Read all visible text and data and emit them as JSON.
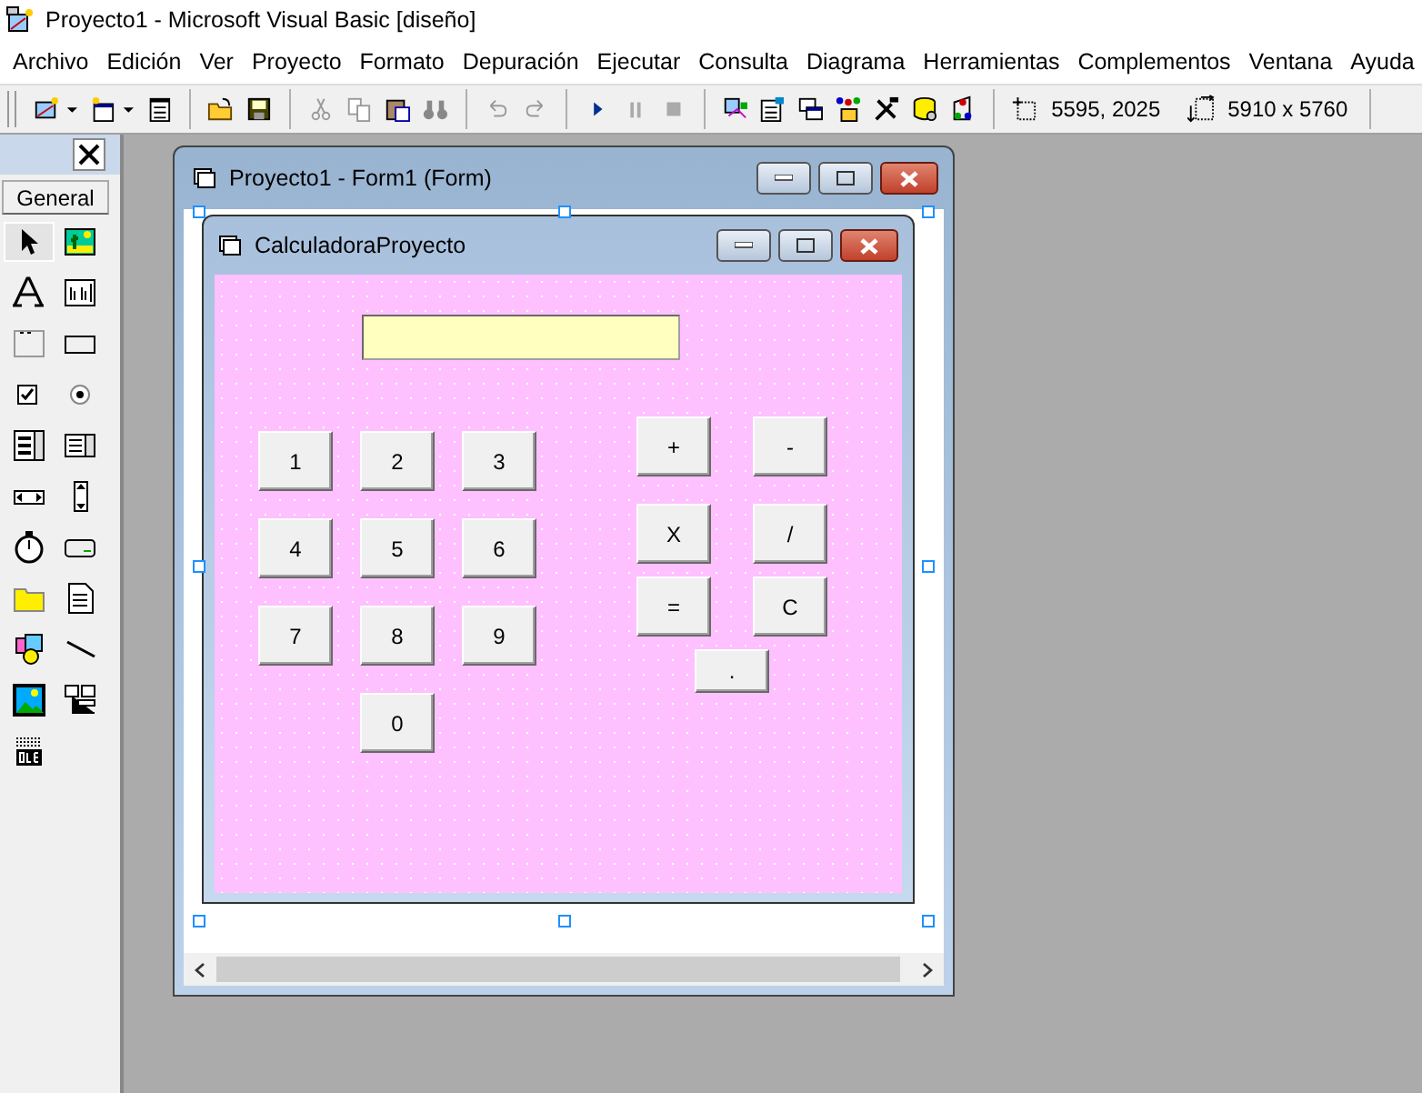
{
  "window": {
    "title": "Proyecto1 - Microsoft Visual Basic [diseño]"
  },
  "menu": [
    "Archivo",
    "Edición",
    "Ver",
    "Proyecto",
    "Formato",
    "Depuración",
    "Ejecutar",
    "Consulta",
    "Diagrama",
    "Herramientas",
    "Complementos",
    "Ventana",
    "Ayuda"
  ],
  "toolbar": {
    "position": "5595, 2025",
    "size": "5910 x 5760"
  },
  "toolbox": {
    "tab": "General"
  },
  "designer": {
    "title": "Proyecto1 - Form1 (Form)",
    "form": {
      "title": "CalculadoraProyecto",
      "buttons": [
        "1",
        "2",
        "3",
        "4",
        "5",
        "6",
        "7",
        "8",
        "9",
        "0",
        "+",
        "-",
        "X",
        "/",
        "=",
        "C",
        "."
      ]
    }
  }
}
